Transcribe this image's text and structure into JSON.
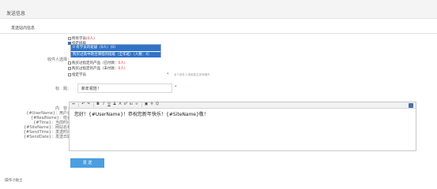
{
  "header": {
    "title": "发送信息"
  },
  "section": {
    "title": "发送站内信息"
  },
  "form": {
    "receiver_label": "收件人选择：",
    "options": [
      {
        "label": "所有学员",
        "count": "(0人)",
        "checked": false
      },
      {
        "label": "指定班级",
        "count": "",
        "checked": true
      },
      {
        "label": "购买过指定的产品（已付款：",
        "count": "0人)",
        "checked": false
      },
      {
        "label": "购买过指定的产品（未付款：",
        "count": "0人)",
        "checked": false
      },
      {
        "label": "指定学员",
        "count": "",
        "checked": false
      }
    ],
    "class_list": [
      "0  有学员的班级（0人）(0)",
      "购买过高中政治课程的班级（全年班）（人数：4）"
    ],
    "hint": "多个收件人请用英文逗号隔开",
    "title_label": "标　题：",
    "title_value": "新年祝愿！",
    "content_label_lines": [
      "内　容：",
      "{#UserName}：用户名",
      "{#RealName}：姓名",
      "{#Time}：当前时间",
      "{#SiteName}：网站名称",
      "{#SendTime}：发送时间",
      "{#SendDate}：发送日期"
    ],
    "editor_content": "您好！{#UserName}！恭祝您新年快乐！{#SiteName}敬！",
    "submit_label": "发 送"
  },
  "footer": {
    "text": "操作小贴士"
  },
  "colors": {
    "accent": "#4a9fe0",
    "selection": "#2f73c9",
    "required": "#e03030"
  }
}
